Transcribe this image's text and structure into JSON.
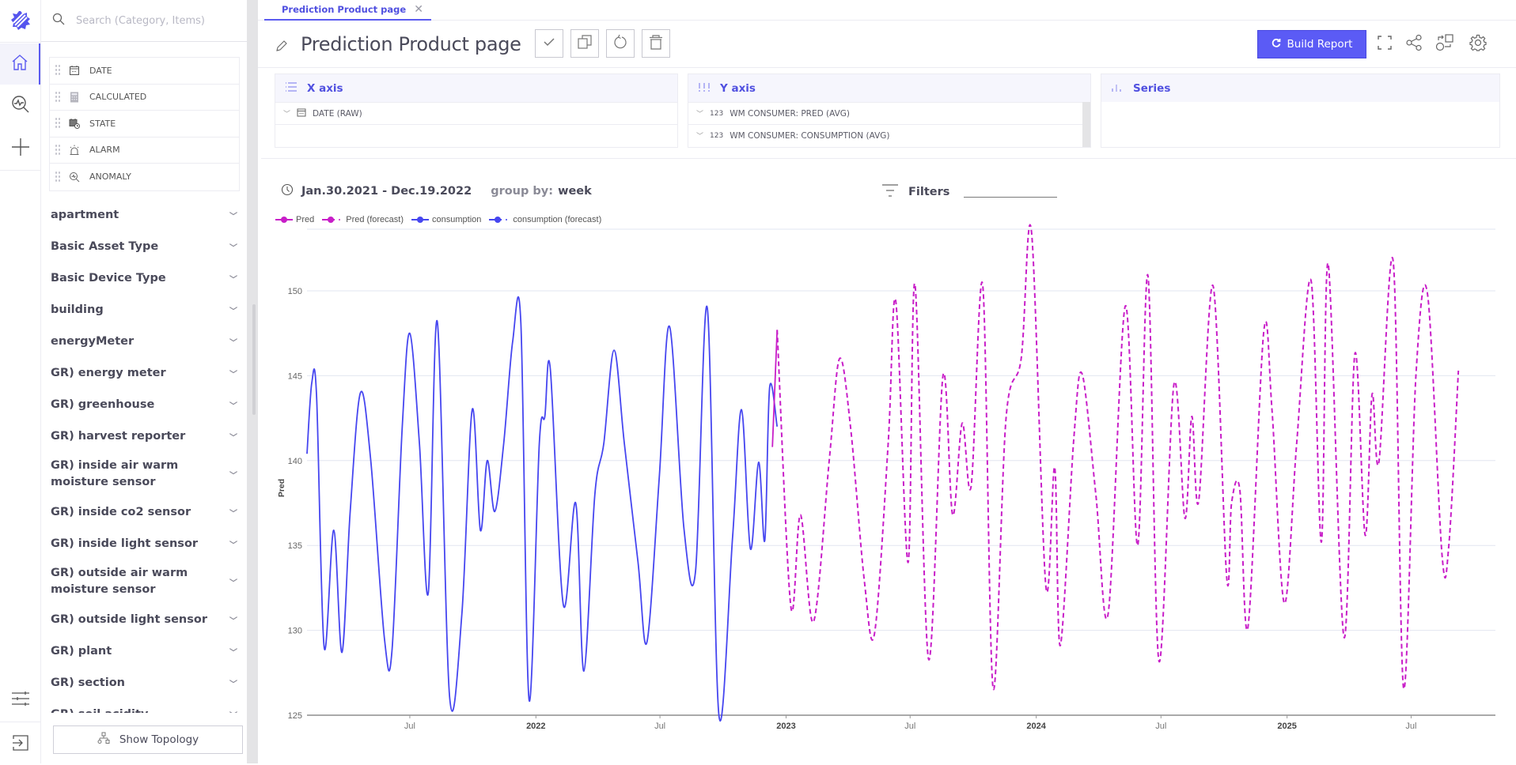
{
  "sidebar": {
    "search_placeholder": "Search (Category, Items)",
    "fields": [
      {
        "label": "DATE",
        "icon": "calendar-icon"
      },
      {
        "label": "CALCULATED",
        "icon": "calculator-icon"
      },
      {
        "label": "STATE",
        "icon": "state-calendar-icon"
      },
      {
        "label": "ALARM",
        "icon": "alarm-icon"
      },
      {
        "label": "ANOMALY",
        "icon": "anomaly-search-icon"
      }
    ],
    "categories": [
      "apartment",
      "Basic Asset Type",
      "Basic Device Type",
      "building",
      "energyMeter",
      "GR) energy meter",
      "GR) greenhouse",
      "GR) harvest reporter",
      "GR) inside air warm moisture sensor",
      "GR) inside co2 sensor",
      "GR) inside light sensor",
      "GR) outside air warm moisture sensor",
      "GR) outside light sensor",
      "GR) plant",
      "GR) section",
      "GR) soil acidity"
    ],
    "show_topology_label": "Show Topology"
  },
  "rail": {
    "items": [
      "logo-icon",
      "home-icon",
      "analytics-search-icon",
      "plus-icon",
      "sliders-icon",
      "logout-icon"
    ]
  },
  "tab": {
    "label": "Prediction Product page"
  },
  "header": {
    "title": "Prediction Product page",
    "build_report_label": "Build Report"
  },
  "axes": {
    "x": {
      "title": "X axis",
      "items": [
        "DATE (RAW)"
      ]
    },
    "y": {
      "title": "Y axis",
      "items": [
        "WM CONSUMER: PRED (AVG)",
        "WM CONSUMER: CONSUMPTION (AVG)"
      ],
      "item_type_label": "123"
    },
    "series": {
      "title": "Series",
      "items": []
    }
  },
  "report": {
    "date_range": "Jan.30.2021 - Dec.19.2022",
    "group_by_label": "group by:",
    "group_by_value": "week",
    "filters_label": "Filters"
  },
  "colors": {
    "accent": "#5b5bf5",
    "pred": "#c81ec8",
    "consumption": "#4646f0"
  },
  "chart_data": {
    "type": "line",
    "title": "",
    "xlabel": "",
    "ylabel": "Pred",
    "ylim": [
      125,
      152.5
    ],
    "yticks": [
      125,
      130,
      135,
      140,
      145,
      150
    ],
    "xlim": [
      "2021-02-01",
      "2025-11-01"
    ],
    "xticks": [
      {
        "date": "2021-07-01",
        "label": "Jul",
        "bold": false
      },
      {
        "date": "2022-01-01",
        "label": "2022",
        "bold": true
      },
      {
        "date": "2022-07-01",
        "label": "Jul",
        "bold": false
      },
      {
        "date": "2023-01-01",
        "label": "2023",
        "bold": true
      },
      {
        "date": "2023-07-01",
        "label": "Jul",
        "bold": false
      },
      {
        "date": "2024-01-01",
        "label": "2024",
        "bold": true
      },
      {
        "date": "2024-07-01",
        "label": "Jul",
        "bold": false
      },
      {
        "date": "2025-01-01",
        "label": "2025",
        "bold": true
      },
      {
        "date": "2025-07-01",
        "label": "Jul",
        "bold": false
      }
    ],
    "grid": true,
    "legend_position": "top-left",
    "legend": [
      "Pred",
      "Pred (forecast)",
      "consumption",
      "consumption (forecast)"
    ],
    "series": [
      {
        "name": "consumption",
        "style": "solid",
        "color": "#4646f0",
        "points": [
          [
            "2021-02-01",
            140.4
          ],
          [
            "2021-02-08",
            144.6
          ],
          [
            "2021-02-15",
            143.8
          ],
          [
            "2021-02-26",
            129.0
          ],
          [
            "2021-03-12",
            135.9
          ],
          [
            "2021-03-24",
            128.7
          ],
          [
            "2021-04-05",
            137.0
          ],
          [
            "2021-04-20",
            144.0
          ],
          [
            "2021-05-05",
            140.0
          ],
          [
            "2021-05-25",
            129.5
          ],
          [
            "2021-06-05",
            128.8
          ],
          [
            "2021-06-20",
            142.0
          ],
          [
            "2021-07-01",
            147.5
          ],
          [
            "2021-07-15",
            141.0
          ],
          [
            "2021-07-28",
            132.2
          ],
          [
            "2021-08-10",
            148.2
          ],
          [
            "2021-08-28",
            126.1
          ],
          [
            "2021-09-15",
            131.0
          ],
          [
            "2021-09-30",
            143.0
          ],
          [
            "2021-10-12",
            135.9
          ],
          [
            "2021-10-22",
            140.0
          ],
          [
            "2021-11-02",
            137.0
          ],
          [
            "2021-11-15",
            141.0
          ],
          [
            "2021-11-28",
            147.0
          ],
          [
            "2021-12-10",
            148.1
          ],
          [
            "2021-12-22",
            125.9
          ],
          [
            "2022-01-06",
            141.0
          ],
          [
            "2022-01-14",
            142.6
          ],
          [
            "2022-01-22",
            145.4
          ],
          [
            "2022-02-10",
            131.5
          ],
          [
            "2022-02-28",
            137.5
          ],
          [
            "2022-03-12",
            127.6
          ],
          [
            "2022-03-28",
            138.0
          ],
          [
            "2022-04-10",
            141.0
          ],
          [
            "2022-04-25",
            146.5
          ],
          [
            "2022-05-10",
            141.0
          ],
          [
            "2022-05-30",
            134.0
          ],
          [
            "2022-06-12",
            129.3
          ],
          [
            "2022-06-30",
            139.0
          ],
          [
            "2022-07-15",
            147.9
          ],
          [
            "2022-08-05",
            136.0
          ],
          [
            "2022-08-22",
            133.5
          ],
          [
            "2022-09-08",
            149.0
          ],
          [
            "2022-09-25",
            125.0
          ],
          [
            "2022-10-15",
            135.5
          ],
          [
            "2022-10-28",
            143.0
          ],
          [
            "2022-11-10",
            134.8
          ],
          [
            "2022-11-22",
            139.9
          ],
          [
            "2022-12-01",
            135.3
          ],
          [
            "2022-12-08",
            144.3
          ],
          [
            "2022-12-19",
            142.0
          ]
        ]
      },
      {
        "name": "Pred",
        "style": "solid",
        "color": "#c81ec8",
        "points": [
          [
            "2022-12-12",
            140.8
          ],
          [
            "2022-12-19",
            147.7
          ]
        ]
      },
      {
        "name": "Pred (forecast)",
        "style": "dashed",
        "color": "#c81ec8",
        "points": [
          [
            "2022-12-19",
            147.7
          ],
          [
            "2023-01-08",
            131.4
          ],
          [
            "2023-01-22",
            136.8
          ],
          [
            "2023-02-10",
            130.5
          ],
          [
            "2023-03-05",
            140.0
          ],
          [
            "2023-03-20",
            146.0
          ],
          [
            "2023-04-05",
            142.0
          ],
          [
            "2023-04-25",
            133.0
          ],
          [
            "2023-05-10",
            129.8
          ],
          [
            "2023-05-30",
            141.0
          ],
          [
            "2023-06-10",
            149.4
          ],
          [
            "2023-06-28",
            134.0
          ],
          [
            "2023-07-08",
            150.4
          ],
          [
            "2023-07-28",
            128.3
          ],
          [
            "2023-08-18",
            145.0
          ],
          [
            "2023-09-01",
            136.8
          ],
          [
            "2023-09-15",
            142.2
          ],
          [
            "2023-09-28",
            138.5
          ],
          [
            "2023-10-15",
            150.3
          ],
          [
            "2023-10-30",
            126.6
          ],
          [
            "2023-11-18",
            142.5
          ],
          [
            "2023-12-10",
            146.0
          ],
          [
            "2023-12-25",
            153.5
          ],
          [
            "2024-01-15",
            132.6
          ],
          [
            "2024-01-28",
            139.6
          ],
          [
            "2024-02-05",
            129.1
          ],
          [
            "2024-02-25",
            141.4
          ],
          [
            "2024-03-08",
            145.1
          ],
          [
            "2024-03-28",
            138.0
          ],
          [
            "2024-04-15",
            131.0
          ],
          [
            "2024-05-10",
            149.1
          ],
          [
            "2024-05-28",
            135.0
          ],
          [
            "2024-06-12",
            150.9
          ],
          [
            "2024-06-28",
            128.2
          ],
          [
            "2024-07-20",
            144.5
          ],
          [
            "2024-08-05",
            136.6
          ],
          [
            "2024-08-15",
            142.6
          ],
          [
            "2024-08-25",
            137.6
          ],
          [
            "2024-09-15",
            150.3
          ],
          [
            "2024-10-05",
            133.1
          ],
          [
            "2024-10-12",
            137.5
          ],
          [
            "2024-10-24",
            138.3
          ],
          [
            "2024-11-05",
            130.2
          ],
          [
            "2024-11-28",
            147.6
          ],
          [
            "2024-12-10",
            143.0
          ],
          [
            "2024-12-28",
            131.6
          ],
          [
            "2025-01-15",
            141.0
          ],
          [
            "2025-02-05",
            150.6
          ],
          [
            "2025-02-20",
            135.2
          ],
          [
            "2025-03-02",
            151.6
          ],
          [
            "2025-03-25",
            129.6
          ],
          [
            "2025-04-10",
            146.3
          ],
          [
            "2025-04-25",
            135.6
          ],
          [
            "2025-05-05",
            143.9
          ],
          [
            "2025-05-15",
            139.9
          ],
          [
            "2025-06-05",
            151.7
          ],
          [
            "2025-06-20",
            126.6
          ],
          [
            "2025-07-08",
            145.0
          ],
          [
            "2025-07-25",
            149.8
          ],
          [
            "2025-08-15",
            134.5
          ],
          [
            "2025-08-25",
            135.0
          ],
          [
            "2025-09-08",
            145.3
          ]
        ]
      },
      {
        "name": "consumption (forecast)",
        "style": "dashed",
        "color": "#4646f0",
        "points": []
      }
    ]
  }
}
